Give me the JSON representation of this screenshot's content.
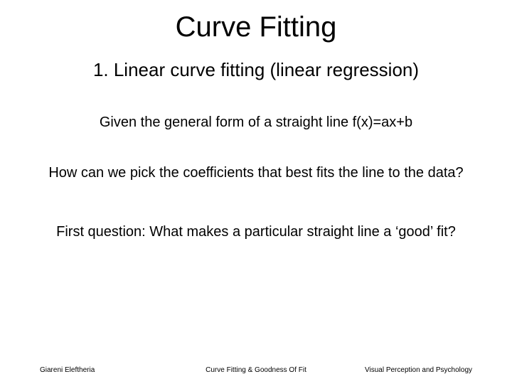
{
  "title": "Curve Fitting",
  "subtitle": "1. Linear curve fitting (linear regression)",
  "line1": "Given the general form of a straight line f(x)=ax+b",
  "line2": "How can we pick the coefficients that best fits the line to the data?",
  "line3": "First question: What makes a particular straight line a ‘good’ fit?",
  "footer": {
    "left": "Giareni Eleftheria",
    "center": "Curve Fitting & Goodness Of Fit",
    "right": "Visual Perception and Psychology"
  }
}
